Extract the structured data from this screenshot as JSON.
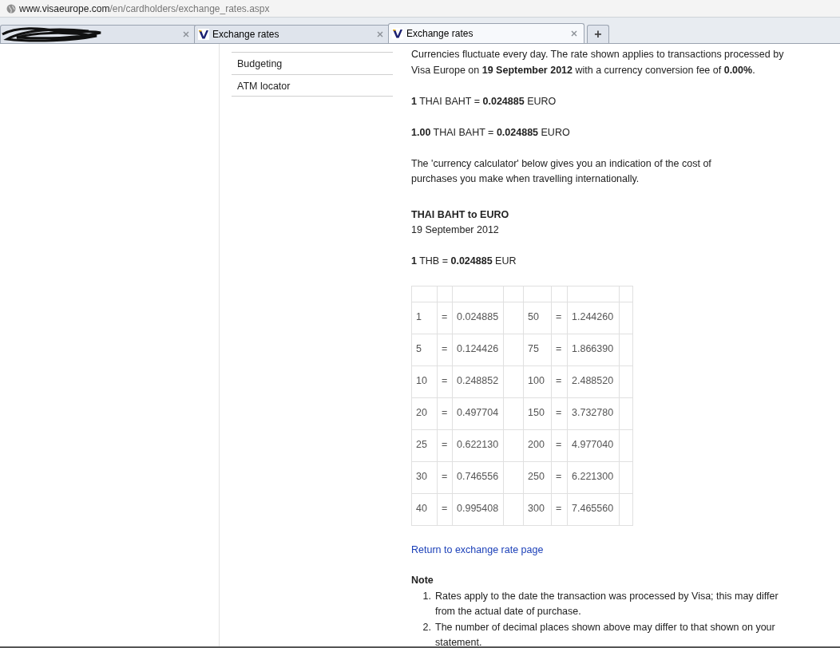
{
  "address_bar": {
    "url_domain": "www.visaeurope.com",
    "url_path": "/en/cardholders/exchange_rates.aspx"
  },
  "tabs": [
    {
      "kind": "redacted",
      "selected": false
    },
    {
      "kind": "page",
      "label": "Exchange rates",
      "selected": false
    },
    {
      "kind": "page",
      "label": "Exchange rates",
      "selected": true
    }
  ],
  "new_tab": "+",
  "sidebar": {
    "items": [
      "Budgeting",
      "ATM locator"
    ]
  },
  "intro": "Currencies fluctuate every day. The rate shown applies to transactions processed by Visa Europe on **19 September 2012** with a currency conversion fee of **0.00%**.",
  "rates": [
    "**1** THAI BAHT = **0.024885** EURO",
    "**1.00** THAI BAHT = **0.024885** EURO"
  ],
  "calculator_note": "The 'currency calculator' below gives you an indication of the cost of purchases you make when travelling internationally.",
  "calculator": {
    "title": "THAI BAHT to EURO",
    "date": "19 September 2012",
    "rate": "**1** THB = **0.024885** EUR"
  },
  "table": {
    "rows": [
      [
        "1",
        "=",
        "0.024885",
        "50",
        "=",
        "1.244260"
      ],
      [
        "5",
        "=",
        "0.124426",
        "75",
        "=",
        "1.866390"
      ],
      [
        "10",
        "=",
        "0.248852",
        "100",
        "=",
        "2.488520"
      ],
      [
        "20",
        "=",
        "0.497704",
        "150",
        "=",
        "3.732780"
      ],
      [
        "25",
        "=",
        "0.622130",
        "200",
        "=",
        "4.977040"
      ],
      [
        "30",
        "=",
        "0.746556",
        "250",
        "=",
        "6.221300"
      ],
      [
        "40",
        "=",
        "0.995408",
        "300",
        "=",
        "7.465560"
      ]
    ]
  },
  "return_link": "Return to exchange rate page",
  "note": {
    "title": "Note",
    "items": [
      {
        "number": "1.",
        "text": "Rates apply to the date the transaction was processed by Visa; this may differ from the actual date of purchase."
      },
      {
        "number": "2.",
        "text": "The number of decimal places shown above may differ to that shown on your statement."
      }
    ]
  }
}
